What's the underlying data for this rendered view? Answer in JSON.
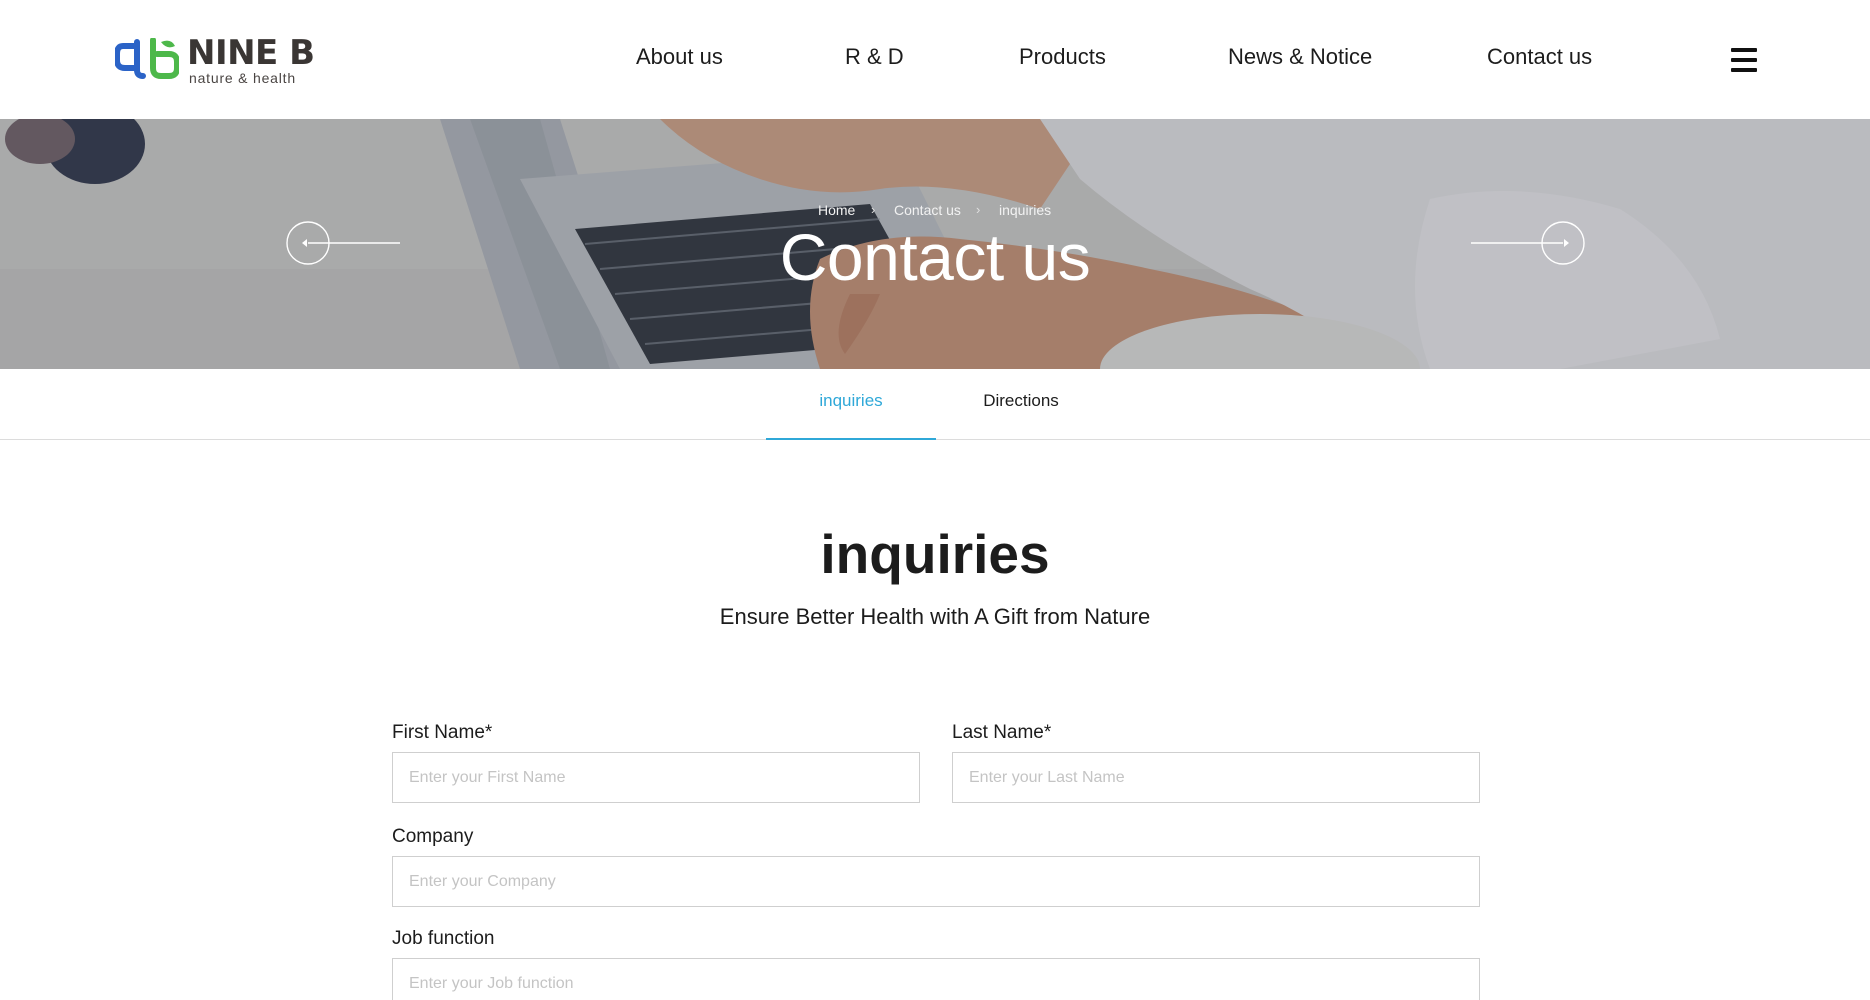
{
  "brand": {
    "name": "NINE B",
    "tagline": "nature & health",
    "colors": {
      "blue": "#2b63c7",
      "green": "#4db84a",
      "text": "#3a3634"
    }
  },
  "nav": {
    "items": [
      {
        "label": "About us"
      },
      {
        "label": "R & D"
      },
      {
        "label": "Products"
      },
      {
        "label": "News & Notice"
      },
      {
        "label": "Contact us"
      }
    ],
    "menu_icon": "hamburger-icon"
  },
  "hero": {
    "breadcrumb": [
      "Home",
      "Contact us",
      "inquiries"
    ],
    "title": "Contact us",
    "prev_icon": "arrow-left-icon",
    "next_icon": "arrow-right-icon"
  },
  "tabs": {
    "items": [
      {
        "label": "inquiries",
        "active": true
      },
      {
        "label": "Directions",
        "active": false
      }
    ],
    "accent": "#2fa8d8"
  },
  "section": {
    "title": "inquiries",
    "subtitle": "Ensure Better Health with A Gift from Nature"
  },
  "form": {
    "first_name": {
      "label": "First Name*",
      "placeholder": "Enter your First Name",
      "value": ""
    },
    "last_name": {
      "label": "Last Name*",
      "placeholder": "Enter your Last Name",
      "value": ""
    },
    "company": {
      "label": "Company",
      "placeholder": "Enter your Company",
      "value": ""
    },
    "job_function": {
      "label": "Job function",
      "placeholder": "Enter your Job function",
      "value": ""
    }
  }
}
